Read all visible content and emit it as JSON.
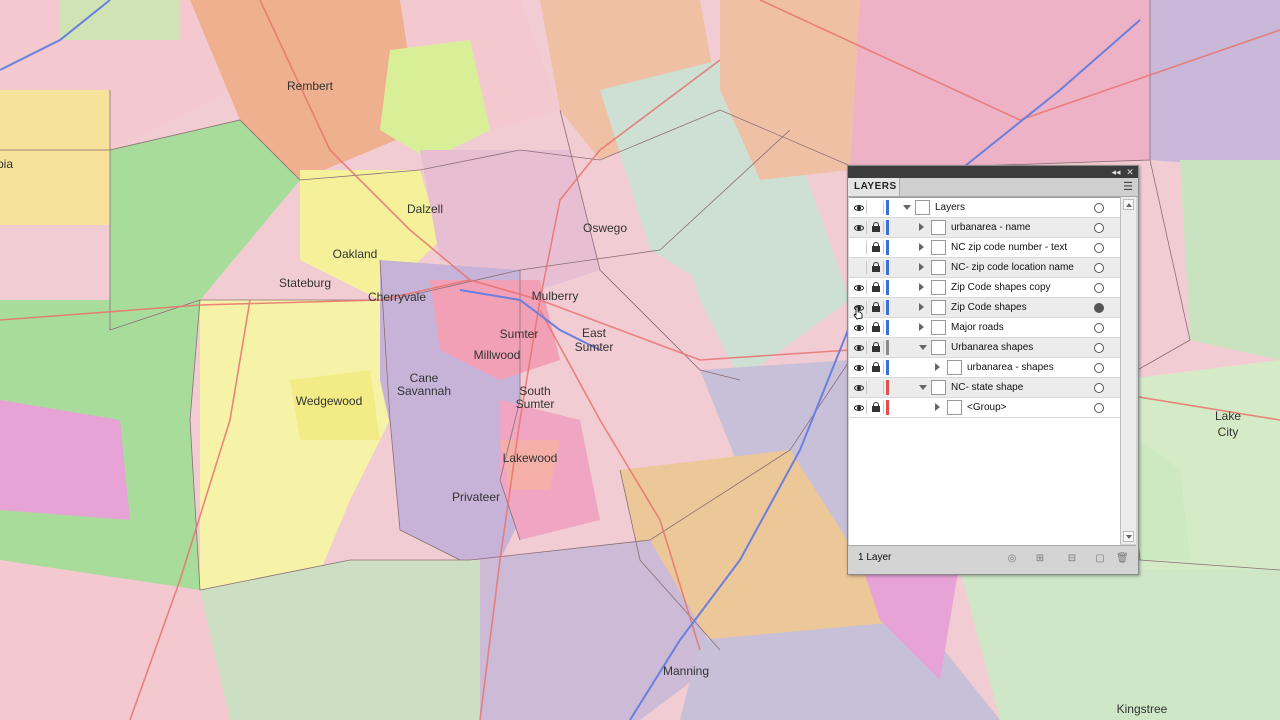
{
  "map": {
    "place_labels": [
      {
        "name": "Rembert"
      },
      {
        "name": "Dalzell"
      },
      {
        "name": "Oswego"
      },
      {
        "name": "Oakland"
      },
      {
        "name": "Stateburg"
      },
      {
        "name": "Cherryvale"
      },
      {
        "name": "Mulberry"
      },
      {
        "name": "Sumter"
      },
      {
        "name": "East"
      },
      {
        "name": "Sumter"
      },
      {
        "name": "Millwood"
      },
      {
        "name": "Cane"
      },
      {
        "name": "Savannah"
      },
      {
        "name": "South"
      },
      {
        "name": "Sumter"
      },
      {
        "name": "Wedgewood"
      },
      {
        "name": "Lakewood"
      },
      {
        "name": "Privateer"
      },
      {
        "name": "Manning"
      },
      {
        "name": "Lake"
      },
      {
        "name": "City"
      },
      {
        "name": "Kingstree"
      },
      {
        "name": "bia"
      }
    ]
  },
  "layers_panel": {
    "tab_label": "LAYERS",
    "footer_count": "1 Layer",
    "colors": {
      "blue": "#3a6fd8",
      "gray": "#8a8a8a",
      "red": "#e0504a"
    },
    "rows": [
      {
        "name": "Layers",
        "indent": 0,
        "visible": true,
        "locked": false,
        "expanded": true,
        "bar": "blue",
        "thumb": "pen-icon",
        "target_filled": false
      },
      {
        "name": "urbanarea - name",
        "indent": 1,
        "visible": true,
        "locked": true,
        "expanded": false,
        "bar": "blue",
        "thumb": "blank-icon",
        "target_filled": false
      },
      {
        "name": "NC zip code number - text",
        "indent": 1,
        "visible": false,
        "locked": true,
        "expanded": false,
        "bar": "blue",
        "thumb": "blank-icon",
        "target_filled": false
      },
      {
        "name": "NC- zip code location name",
        "indent": 1,
        "visible": false,
        "locked": true,
        "expanded": false,
        "bar": "blue",
        "thumb": "blank-icon",
        "target_filled": false
      },
      {
        "name": "Zip Code shapes copy",
        "indent": 1,
        "visible": true,
        "locked": true,
        "expanded": false,
        "bar": "blue",
        "thumb": "pen-icon",
        "target_filled": false
      },
      {
        "name": "Zip Code shapes",
        "indent": 1,
        "visible": true,
        "locked": true,
        "expanded": false,
        "bar": "blue",
        "thumb": "shape-icon",
        "target_filled": true
      },
      {
        "name": "Major roads",
        "indent": 1,
        "visible": true,
        "locked": true,
        "expanded": false,
        "bar": "blue",
        "thumb": "road-icon",
        "target_filled": false
      },
      {
        "name": "Urbanarea shapes",
        "indent": 1,
        "visible": true,
        "locked": true,
        "expanded": true,
        "bar": "gray",
        "thumb": "shape-icon",
        "target_filled": false
      },
      {
        "name": "urbanarea - shapes",
        "indent": 2,
        "visible": true,
        "locked": true,
        "expanded": false,
        "bar": "blue",
        "thumb": "shape-icon",
        "target_filled": false
      },
      {
        "name": "NC- state shape",
        "indent": 1,
        "visible": true,
        "locked": false,
        "expanded": true,
        "bar": "red",
        "thumb": "shape-icon",
        "target_filled": false
      },
      {
        "name": "<Group>",
        "indent": 2,
        "visible": true,
        "locked": true,
        "expanded": false,
        "bar": "red",
        "thumb": "shape-icon",
        "target_filled": false
      }
    ]
  }
}
